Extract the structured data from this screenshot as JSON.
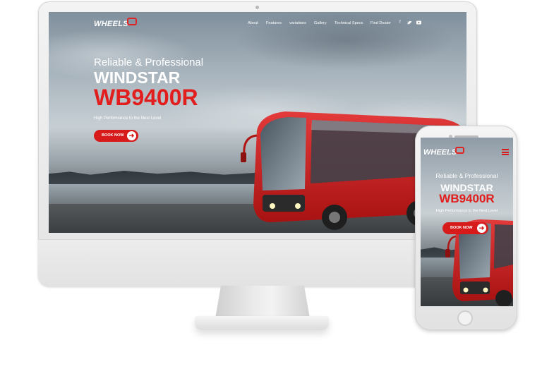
{
  "desktop": {
    "logo": "WHEELS",
    "nav": [
      "About",
      "Features",
      "variations",
      "Gallery",
      "Technical Specs",
      "Find Dealer"
    ],
    "social": [
      "f",
      "t",
      "yt"
    ],
    "hero": {
      "kicker": "Reliable & Professional",
      "title_line1": "WINDSTAR",
      "title_line2": "WB9400R",
      "tagline": "High Performance to the Next Level",
      "button": "BOOK NOW",
      "button_icon": "➜"
    }
  },
  "mobile": {
    "logo": "WHEELS",
    "menu_icon": "hamburger-icon",
    "hero": {
      "kicker": "Reliable & Professional",
      "title_line1": "WINDSTAR",
      "title_line2": "WB9400R",
      "tagline": "High Performance to the Next Level",
      "button": "BOOK NOW",
      "button_icon": "➜"
    }
  },
  "colors": {
    "accent": "#d71a1a",
    "title_red": "#e11d1d",
    "text": "#ffffff"
  }
}
